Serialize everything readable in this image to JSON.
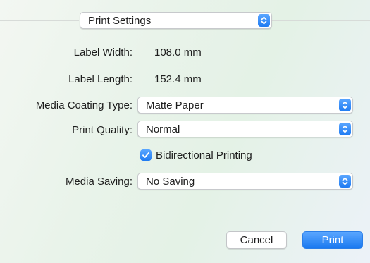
{
  "panel": {
    "section_selector": "Print Settings"
  },
  "fields": {
    "label_width": {
      "label": "Label Width:",
      "value": "108.0 mm"
    },
    "label_length": {
      "label": "Label Length:",
      "value": "152.4 mm"
    },
    "media_coating_type": {
      "label": "Media Coating Type:",
      "value": "Matte Paper"
    },
    "print_quality": {
      "label": "Print Quality:",
      "value": "Normal"
    },
    "bidirectional_printing": {
      "label": "Bidirectional Printing",
      "checked": true
    },
    "media_saving": {
      "label": "Media Saving:",
      "value": "No Saving"
    }
  },
  "buttons": {
    "cancel": "Cancel",
    "print": "Print"
  },
  "colors": {
    "accent": "#1f7bf2"
  }
}
